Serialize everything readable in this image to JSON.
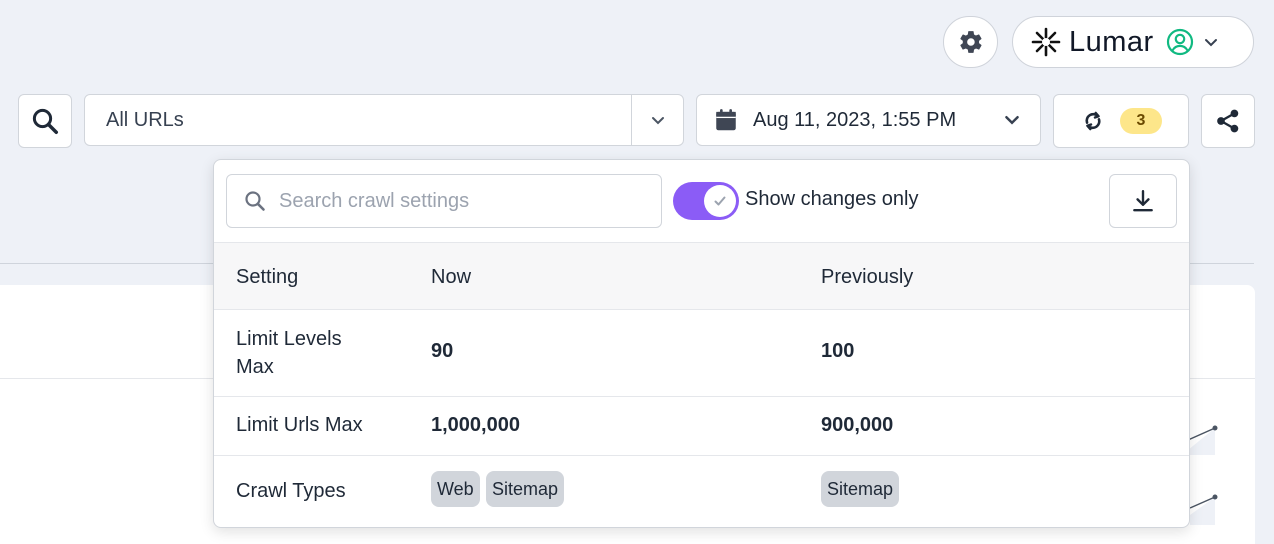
{
  "header": {
    "brand": "Lumar",
    "settings_icon": "gear-icon",
    "account_icon": "user-circle-icon"
  },
  "toolbar": {
    "url_filter_value": "All URLs",
    "date_value": "Aug 11, 2023, 1:55 PM",
    "changes_count": "3"
  },
  "popup": {
    "search_placeholder": "Search crawl settings",
    "toggle_label": "Show changes only",
    "toggle_on": true,
    "columns": {
      "setting": "Setting",
      "now": "Now",
      "previously": "Previously"
    },
    "rows": [
      {
        "setting": "Limit Levels Max",
        "now": "90",
        "previously": "100"
      },
      {
        "setting": "Limit Urls Max",
        "now": "1,000,000",
        "previously": "900,000"
      },
      {
        "setting": "Crawl Types",
        "now_chips": [
          "Web",
          "Sitemap"
        ],
        "previously_chips": [
          "Sitemap"
        ]
      }
    ]
  },
  "colors": {
    "accent": "#8b5cf6",
    "badge": "#fde68a",
    "avatar": "#10b981"
  }
}
